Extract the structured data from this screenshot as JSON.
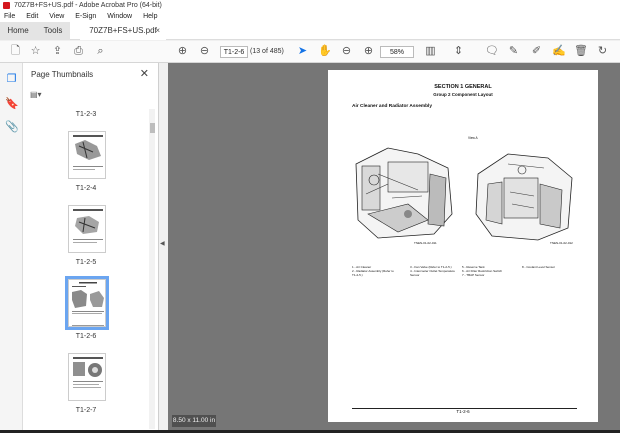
{
  "window": {
    "title": "70Z7B+FS+US.pdf - Adobe Acrobat Pro (64-bit)"
  },
  "menu": [
    "File",
    "Edit",
    "View",
    "E-Sign",
    "Window",
    "Help"
  ],
  "tabs": {
    "home": "Home",
    "tools": "Tools",
    "document": "70Z7B+FS+US.pdf",
    "close": "×"
  },
  "toolbar": {
    "page_input": "T1-2-6",
    "page_count": "(13 of 485)",
    "zoom": "58%"
  },
  "panel": {
    "title": "Page Thumbnails",
    "close": "✕",
    "thumbnails": [
      {
        "label": "T1-2-3"
      },
      {
        "label": "T1-2-4"
      },
      {
        "label": "T1-2-5"
      },
      {
        "label": "T1-2-6",
        "selected": true
      },
      {
        "label": "T1-2-7"
      }
    ]
  },
  "page": {
    "section": "SECTION 1 GENERAL",
    "group": "Group 2 Component Layout",
    "heading": "Air Cleaner and Radiator Assembly",
    "view_label": "View A",
    "code_left": "TNEN-01-02-011",
    "code_right": "TNEN-01-02-012",
    "legend": [
      [
        "1 - Air Cleaner",
        "2 - Radiator Assembly (Refer to T1-2-5.)"
      ],
      [
        "3 - Fan Valve (Refer to T1-2-5.)",
        "4 - Intercooler Outlet Temperature Sensor"
      ],
      [
        "5 - Reserve Tank",
        "6 - Air Filter Restriction Switch",
        "7 - TBAP Sensor"
      ],
      [
        "8 - Coolant Level Sensor"
      ]
    ],
    "footer": "T1-2-6"
  },
  "status": {
    "page_size": "8.50 x 11.00 in"
  }
}
